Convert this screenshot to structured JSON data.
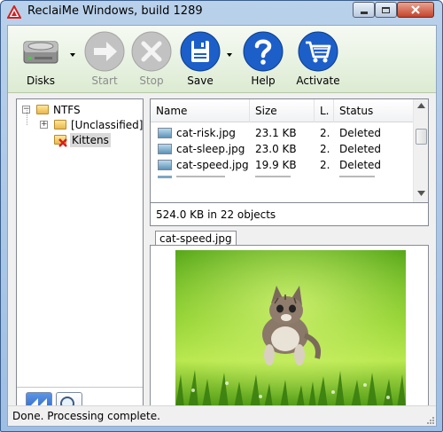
{
  "window": {
    "title": "ReclaiMe Windows, build 1289"
  },
  "toolbar": {
    "buttons": [
      {
        "label": "Disks",
        "icon": "hard-disk-icon",
        "enabled": true
      },
      {
        "label": "Start",
        "icon": "arrow-right-icon",
        "enabled": false
      },
      {
        "label": "Stop",
        "icon": "x-icon",
        "enabled": false
      },
      {
        "label": "Save",
        "icon": "floppy-disk-icon",
        "enabled": true
      },
      {
        "label": "Help",
        "icon": "question-mark-icon",
        "enabled": true
      },
      {
        "label": "Activate",
        "icon": "shopping-cart-icon",
        "enabled": true
      }
    ]
  },
  "tree": {
    "root": {
      "label": "NTFS",
      "expanded": true
    },
    "children": [
      {
        "label": "[Unclassified]",
        "expander": "+"
      },
      {
        "label": "Kittens",
        "selected": true
      }
    ]
  },
  "file_list": {
    "columns": [
      "Name",
      "Size",
      "L.",
      "Status"
    ],
    "rows": [
      {
        "name": "cat-risk.jpg",
        "size": "23.1 KB",
        "l": "2.",
        "status": "Deleted"
      },
      {
        "name": "cat-sleep.jpg",
        "size": "23.0 KB",
        "l": "2.",
        "status": "Deleted"
      },
      {
        "name": "cat-speed.jpg",
        "size": "19.9 KB",
        "l": "2.",
        "status": "Deleted"
      }
    ],
    "summary": "524.0 KB in 22 objects"
  },
  "preview": {
    "tab_label": "cat-speed.jpg"
  },
  "status": {
    "text": "Done. Processing complete."
  },
  "colors": {
    "accent_blue": "#1c5fc9",
    "toolbar_bg": "#e6f0de",
    "window_frame": "#a9c6e6",
    "delete_red": "#d81e1e"
  }
}
